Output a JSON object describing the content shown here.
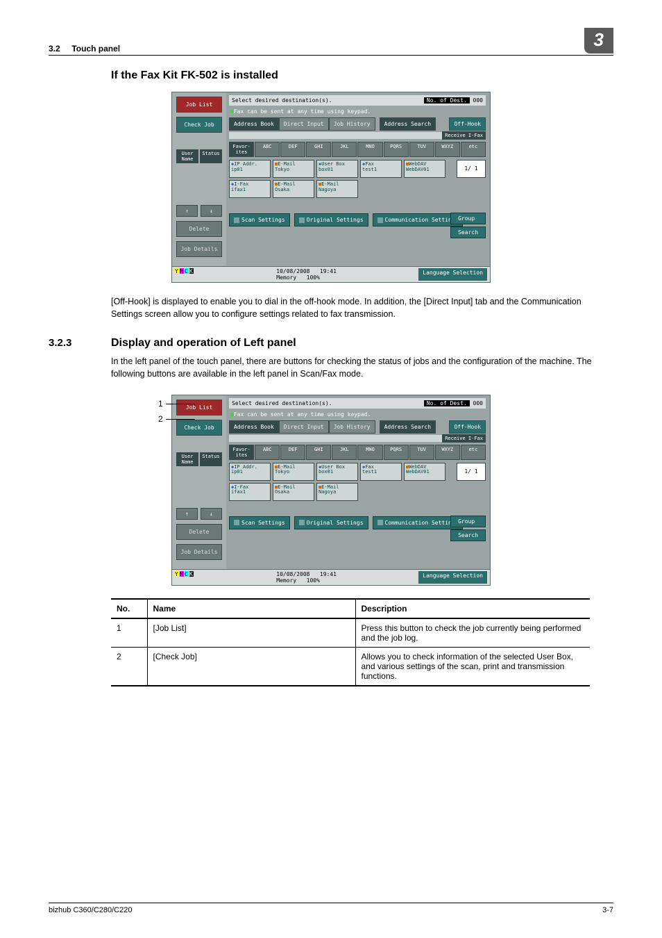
{
  "header": {
    "section": "3.2",
    "title": "Touch panel",
    "chapter": "3"
  },
  "h_installed": "If the Fax Kit FK-502 is installed",
  "screenshot": {
    "left": {
      "job_list": "Job List",
      "check_job": "Check Job",
      "user_name": "User Name",
      "status": "Status",
      "arrow_up": "↑",
      "arrow_down": "↓",
      "delete": "Delete",
      "job_details": "Job Details"
    },
    "title": "Select desired destination(s).",
    "dest_label": "No. of Dest.",
    "dest_count": "000",
    "fax_note": "Fax can be sent at any time using keypad.",
    "tabs": {
      "address_book": "Address Book",
      "direct_input": "Direct Input",
      "job_history": "Job History",
      "address_search": "Address Search",
      "off_hook": "Off-Hook"
    },
    "receive": "Receive I-Fax",
    "letters": [
      "Favor-ites",
      "ABC",
      "DEF",
      "GHI",
      "JKL",
      "MNO",
      "PQRS",
      "TUV",
      "WXYZ",
      "etc"
    ],
    "dests_row1": [
      {
        "t": "IP Addr.",
        "n": "ip01"
      },
      {
        "t": "E-Mail",
        "n": "Tokyo"
      },
      {
        "t": "User Box",
        "n": "box01"
      },
      {
        "t": "Fax",
        "n": "test1"
      },
      {
        "t": "WebDAV",
        "n": "WebDAV01"
      }
    ],
    "dests_row2": [
      {
        "t": "I-Fax",
        "n": "ifax1"
      },
      {
        "t": "E-Mail",
        "n": "Osaka"
      },
      {
        "t": "E-Mail",
        "n": "Nagoya"
      }
    ],
    "page": "1/  1",
    "side": {
      "group": "Group",
      "search": "Search"
    },
    "bottom": {
      "scan": "Scan Settings",
      "original": "Original Settings",
      "comm": "Communication Settings"
    },
    "footer": {
      "date": "10/08/2008",
      "time": "19:41",
      "mem_label": "Memory",
      "mem": "100%",
      "lang": "Language Selection"
    }
  },
  "para1": "[Off-Hook] is displayed to enable you to dial in the off-hook mode. In addition, the [Direct Input] tab and the Communication Settings screen allow you to configure settings related to fax transmission.",
  "section2": {
    "num": "3.2.3",
    "title": "Display and operation of Left panel"
  },
  "para2": "In the left panel of the touch panel, there are buttons for checking the status of jobs and the configuration of the machine. The following buttons are available in the left panel in Scan/Fax mode.",
  "callouts": {
    "n1": "1",
    "n2": "2"
  },
  "table": {
    "head": {
      "no": "No.",
      "name": "Name",
      "desc": "Description"
    },
    "rows": [
      {
        "no": "1",
        "name": "[Job List]",
        "desc": "Press this button to check the job currently being performed and the job log."
      },
      {
        "no": "2",
        "name": "[Check Job]",
        "desc": "Allows you to check information of the selected User Box, and various settings of the scan, print and transmission functions."
      }
    ]
  },
  "footer": {
    "model": "bizhub C360/C280/C220",
    "page": "3-7"
  }
}
